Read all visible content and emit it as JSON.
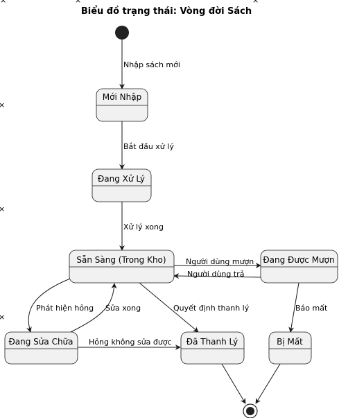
{
  "title": "Biểu đồ trạng thái: Vòng đời Sách",
  "states": {
    "moi_nhap": "Mới Nhập",
    "dang_xu_ly": "Đang Xử Lý",
    "san_sang": "Sẵn Sàng (Trong Kho)",
    "dang_duoc_muon": "Đang Được Mượn",
    "dang_sua_chua": "Đang Sửa Chữa",
    "da_thanh_ly": "Đã Thanh Lý",
    "bi_mat": "Bị Mất"
  },
  "transitions": {
    "nhap_sach_moi": "Nhập sách mới",
    "bat_dau_xu_ly": "Bắt đầu xử lý",
    "xu_ly_xong": "Xử lý xong",
    "nguoi_dung_muon": "Người dùng mượn",
    "nguoi_dung_tra": "Người dùng trả",
    "phat_hien_hong": "Phát hiện hỏng",
    "sua_xong": "Sửa xong",
    "quyet_dinh_thanh_ly": "Quyết định thanh lý",
    "hong_khong_sua_duoc": "Hỏng không sửa được",
    "bao_mat": "Báo mất"
  },
  "colors": {
    "state_fill": "#f1f1f1",
    "stroke": "#181818",
    "start_node": "#222222"
  }
}
